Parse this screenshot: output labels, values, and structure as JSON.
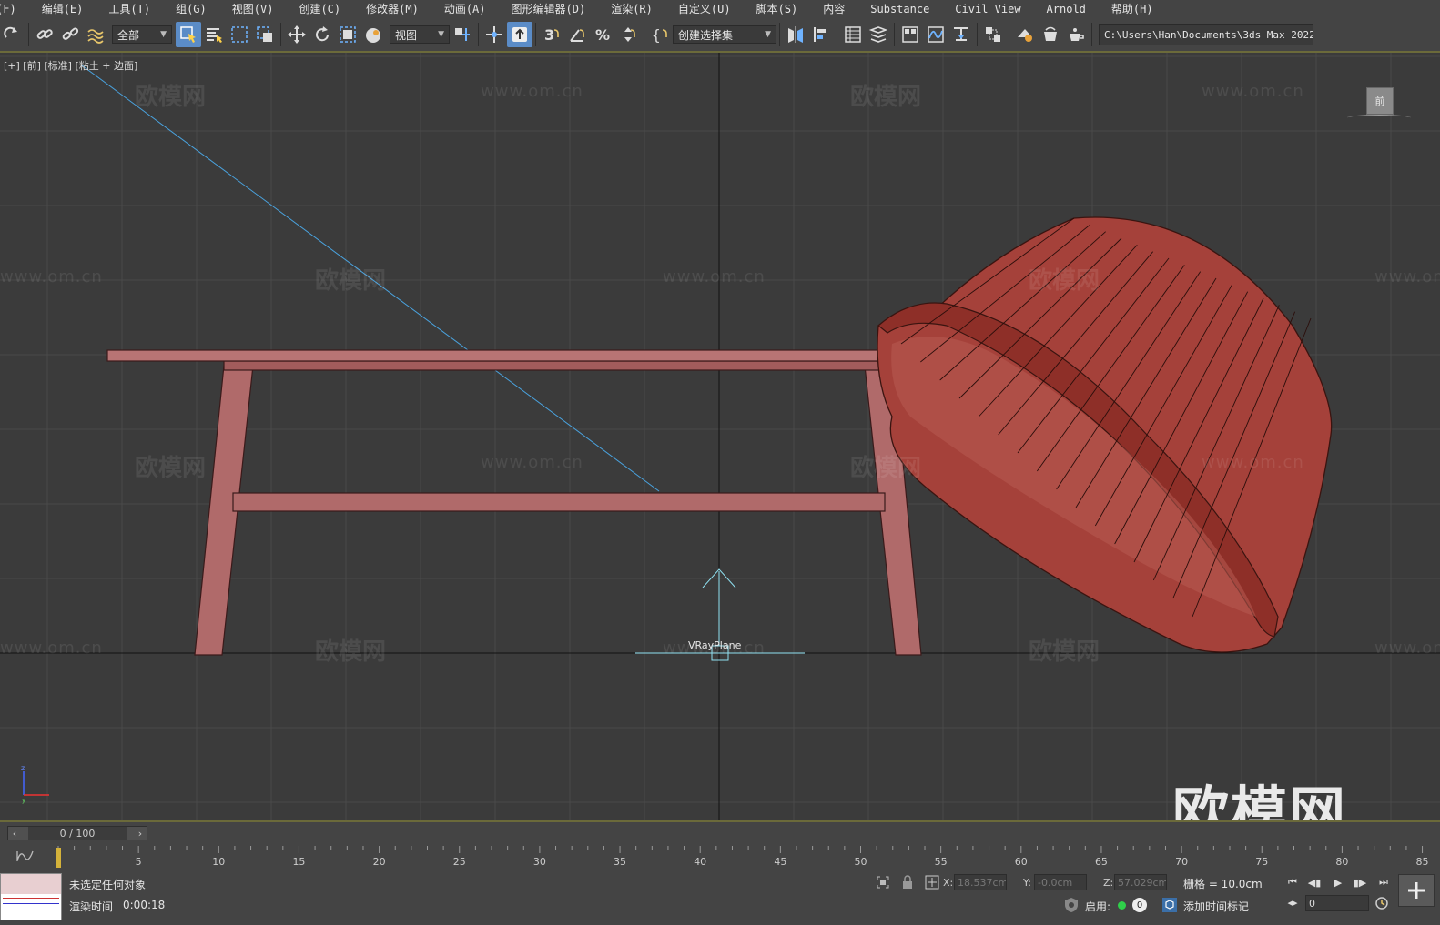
{
  "menu": {
    "items": [
      "(F)",
      "编辑(E)",
      "工具(T)",
      "组(G)",
      "视图(V)",
      "创建(C)",
      "修改器(M)",
      "动画(A)",
      "图形编辑器(D)",
      "渲染(R)",
      "自定义(U)",
      "脚本(S)",
      "内容",
      "Substance",
      "Civil View",
      "Arnold",
      "帮助(H)"
    ]
  },
  "toolbar": {
    "selection_filter": "全部",
    "reference_coord": "视图",
    "named_selection": "创建选择集",
    "project_path": "C:\\Users\\Han\\Documents\\3ds Max 2022",
    "snap_label": "3"
  },
  "viewport": {
    "label": "[+] [前] [标准] [粘土 + 边面]",
    "viewcube_face": "前",
    "object_label": "VRayPlane",
    "watermark_cn": "欧模网",
    "watermark_url": "www.om.cn",
    "brand_logo": "欧模网",
    "colors": {
      "bg": "#3b3b3b",
      "grid": "#4a4a4a",
      "object": "#a5413a",
      "table": "#b06a6a",
      "light_line": "#4aa3df"
    }
  },
  "timeline": {
    "frame_display": "0 / 100",
    "ticks": [
      "5",
      "10",
      "15",
      "20",
      "25",
      "30",
      "35",
      "40",
      "45",
      "50",
      "55",
      "60",
      "65",
      "70",
      "75",
      "80",
      "85"
    ]
  },
  "status": {
    "selection_text": "未选定任何对象",
    "render_time_label": "渲染时间",
    "render_time_value": "0:00:18",
    "x_label": "X:",
    "x_value": "18.537cm",
    "y_label": "Y:",
    "y_value": "-0.0cm",
    "z_label": "Z:",
    "z_value": "57.029cm",
    "grid_text": "栅格 = 10.0cm",
    "enable_label": "启用:",
    "enable_count": "0",
    "add_time_tag": "添加时间标记",
    "frame_field": "0"
  }
}
